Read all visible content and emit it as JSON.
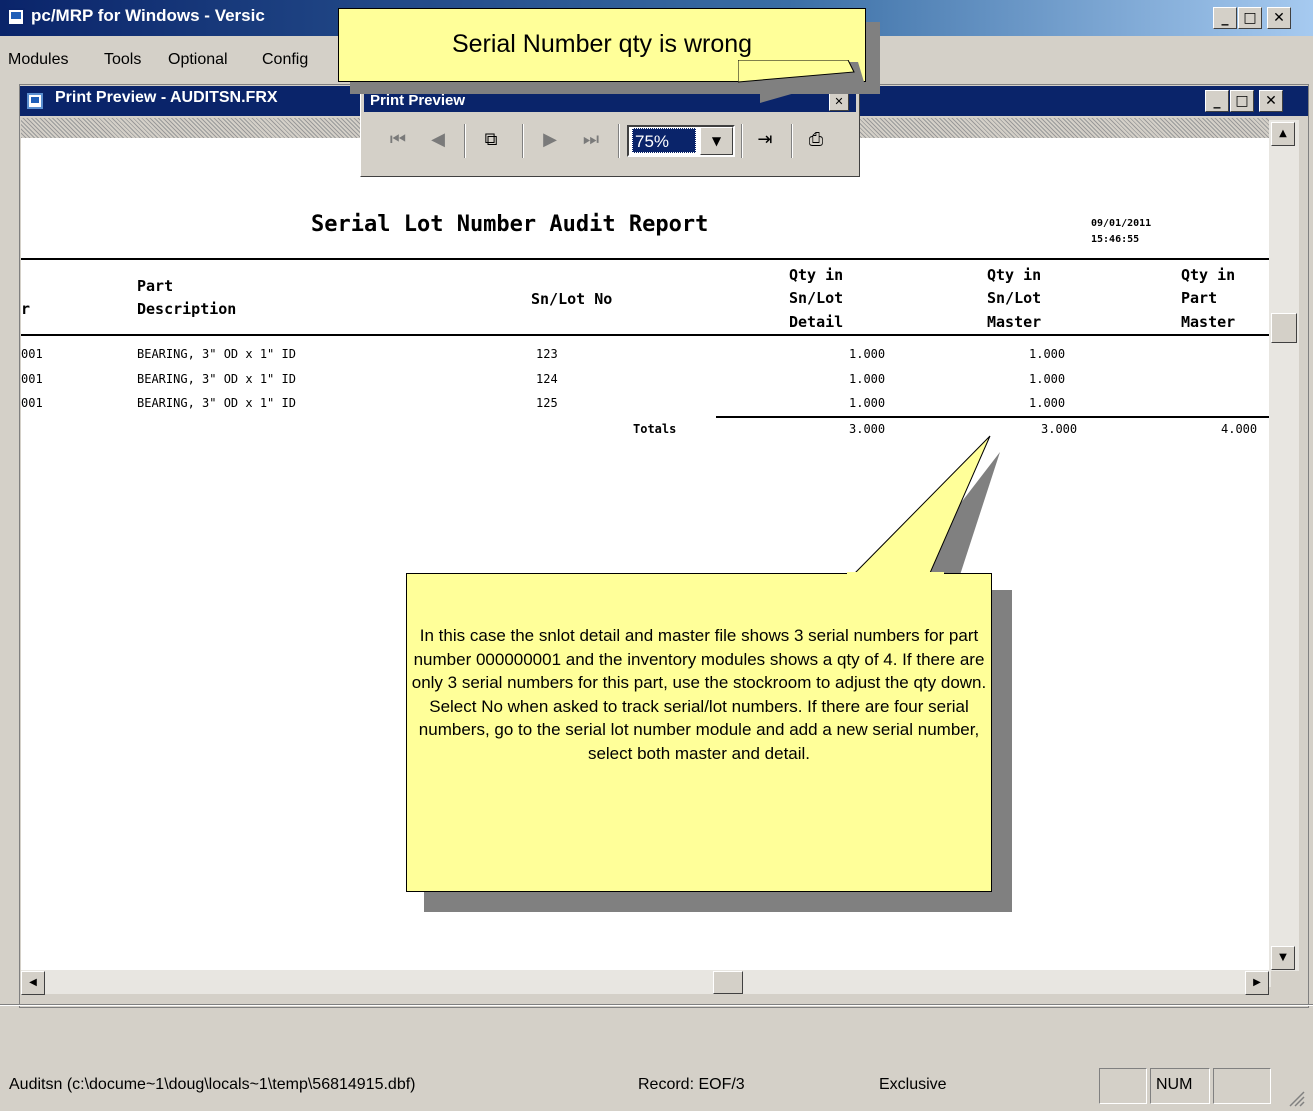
{
  "app": {
    "title": "pc/MRP for Windows - Versic",
    "menu": [
      "Modules",
      "Tools",
      "Optional",
      "Config"
    ]
  },
  "child_window": {
    "title": "Print Preview - AUDITSN.FRX"
  },
  "toolbar": {
    "title": "Print Preview",
    "zoom": "75%",
    "icons": [
      "first-page-icon",
      "prev-page-icon",
      "go-to-page-icon",
      "next-page-icon",
      "last-page-icon",
      "close-preview-icon",
      "printer-icon"
    ]
  },
  "report": {
    "title": "Serial Lot Number Audit Report",
    "date": "09/01/2011",
    "time": "15:46:55",
    "columns": {
      "c0": "r",
      "c1_a": "Part",
      "c1_b": "Description",
      "c2": "Sn/Lot No",
      "c3_a": "Qty in",
      "c3_b": "Sn/Lot",
      "c3_c": "Detail",
      "c4_a": "Qty in",
      "c4_b": "Sn/Lot",
      "c4_c": "Master",
      "c5_a": "Qty in",
      "c5_b": "Part",
      "c5_c": "Master"
    },
    "rows": [
      {
        "part": "001",
        "desc": "BEARING, 3\" OD x 1\" ID",
        "sn": "123",
        "detail": "1.000",
        "master": "1.000"
      },
      {
        "part": "001",
        "desc": "BEARING, 3\" OD x 1\" ID",
        "sn": "124",
        "detail": "1.000",
        "master": "1.000"
      },
      {
        "part": "001",
        "desc": "BEARING, 3\" OD x 1\" ID",
        "sn": "125",
        "detail": "1.000",
        "master": "1.000"
      }
    ],
    "totals": {
      "label": "Totals",
      "detail": "3.000",
      "master": "3.000",
      "part_master": "4.000"
    }
  },
  "callouts": {
    "top": "Serial Number qty is wrong",
    "main": "In this case the snlot detail and master file shows 3 serial numbers for part number 000000001 and the inventory modules shows a qty of 4.  If there are only 3 serial numbers for this part, use the stockroom to adjust the qty down. Select No when asked to track serial/lot numbers.  If there are four serial numbers, go to the serial lot number module and add a new serial number, select both master and detail."
  },
  "status": {
    "file": "Auditsn (c:\\docume~1\\doug\\locals~1\\temp\\56814915.dbf)",
    "record": "Record: EOF/3",
    "mode": "Exclusive",
    "num": "NUM"
  },
  "colors": {
    "titlebar": "#0a246a",
    "callout": "#ffff99"
  }
}
